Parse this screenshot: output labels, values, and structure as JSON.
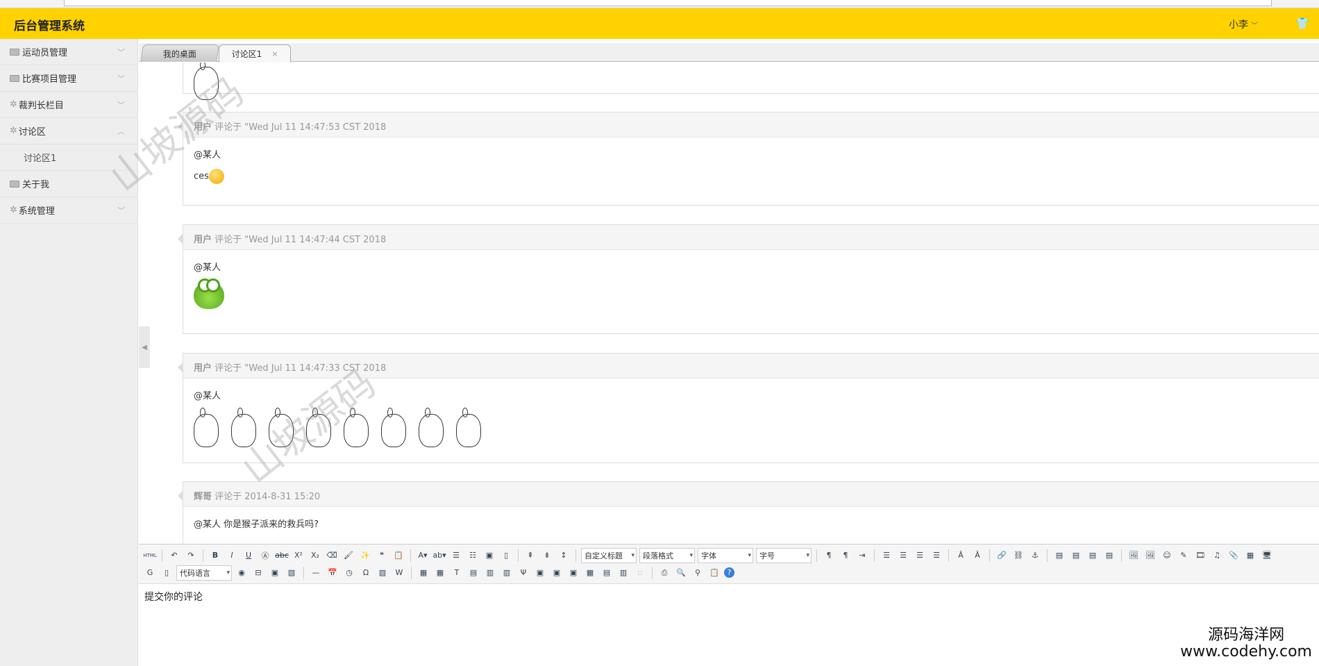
{
  "header": {
    "title": "后台管理系统",
    "user": "小李",
    "shirt_icon": "shirt-icon"
  },
  "sidebar": {
    "items": [
      {
        "label": "运动员管理",
        "icon": "image-icon",
        "expanded": false
      },
      {
        "label": "比赛项目管理",
        "icon": "image-icon",
        "expanded": false
      },
      {
        "label": "裁判长栏目",
        "icon": "gear-icon",
        "expanded": false
      },
      {
        "label": "讨论区",
        "icon": "gear-icon",
        "expanded": true
      },
      {
        "label": "讨论区1",
        "sub": true
      },
      {
        "label": "关于我",
        "icon": "image-icon"
      },
      {
        "label": "系统管理",
        "icon": "gear-icon",
        "expanded": false
      }
    ]
  },
  "tabs": [
    {
      "label": "我的桌面"
    },
    {
      "label": "讨论区1",
      "active": true,
      "close": "×"
    }
  ],
  "comments": [
    {
      "user": "用户",
      "meta": "评论于 \"Wed Jul 11 14:47:53 CST 2018",
      "mention": "@某人",
      "text": "ces"
    },
    {
      "user": "用户",
      "meta": "评论于 \"Wed Jul 11 14:47:44 CST 2018",
      "mention": "@某人"
    },
    {
      "user": "用户",
      "meta": "评论于 \"Wed Jul 11 14:47:33 CST 2018",
      "mention": "@某人"
    },
    {
      "user": "辉哥",
      "meta": "评论于 2014-8-31 15:20",
      "mention": "@某人 你是猴子派来的救兵吗?"
    }
  ],
  "editor": {
    "html_label": "HTML",
    "selects": {
      "heading": "自定义标题",
      "paragraph": "段落格式",
      "font": "字体",
      "size": "字号",
      "code_lang": "代码语言"
    },
    "placeholder": "提交你的评论"
  },
  "watermark": "山坡源码",
  "branding": {
    "name": "源码海洋网",
    "url": "www.codehy.com"
  }
}
